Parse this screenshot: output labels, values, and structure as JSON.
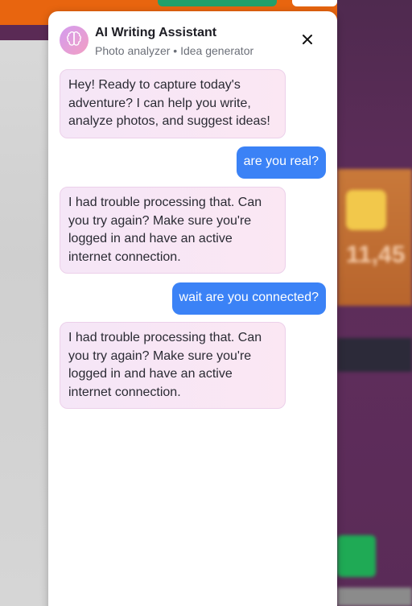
{
  "colors": {
    "accent_user_bubble": "#3b82f6",
    "assistant_bubble": "#f5e6f7",
    "avatar_gradient_start": "#d39cf0",
    "avatar_gradient_end": "#f29fc2"
  },
  "header": {
    "title": "AI Writing Assistant",
    "subtitle": "Photo analyzer • Idea generator",
    "avatar_icon": "brain-icon",
    "close_icon": "close-icon"
  },
  "background": {
    "big_number": "11,45"
  },
  "messages": [
    {
      "role": "assistant",
      "text": "Hey! Ready to capture today's adventure? I can help you write, analyze photos, and suggest ideas!"
    },
    {
      "role": "user",
      "text": "are you real?"
    },
    {
      "role": "assistant",
      "text": "I had trouble processing that. Can you try again? Make sure you're logged in and have an active internet connection."
    },
    {
      "role": "user",
      "text": "wait are you connected?"
    },
    {
      "role": "assistant",
      "text": "I had trouble processing that. Can you try again? Make sure you're logged in and have an active internet connection."
    }
  ]
}
